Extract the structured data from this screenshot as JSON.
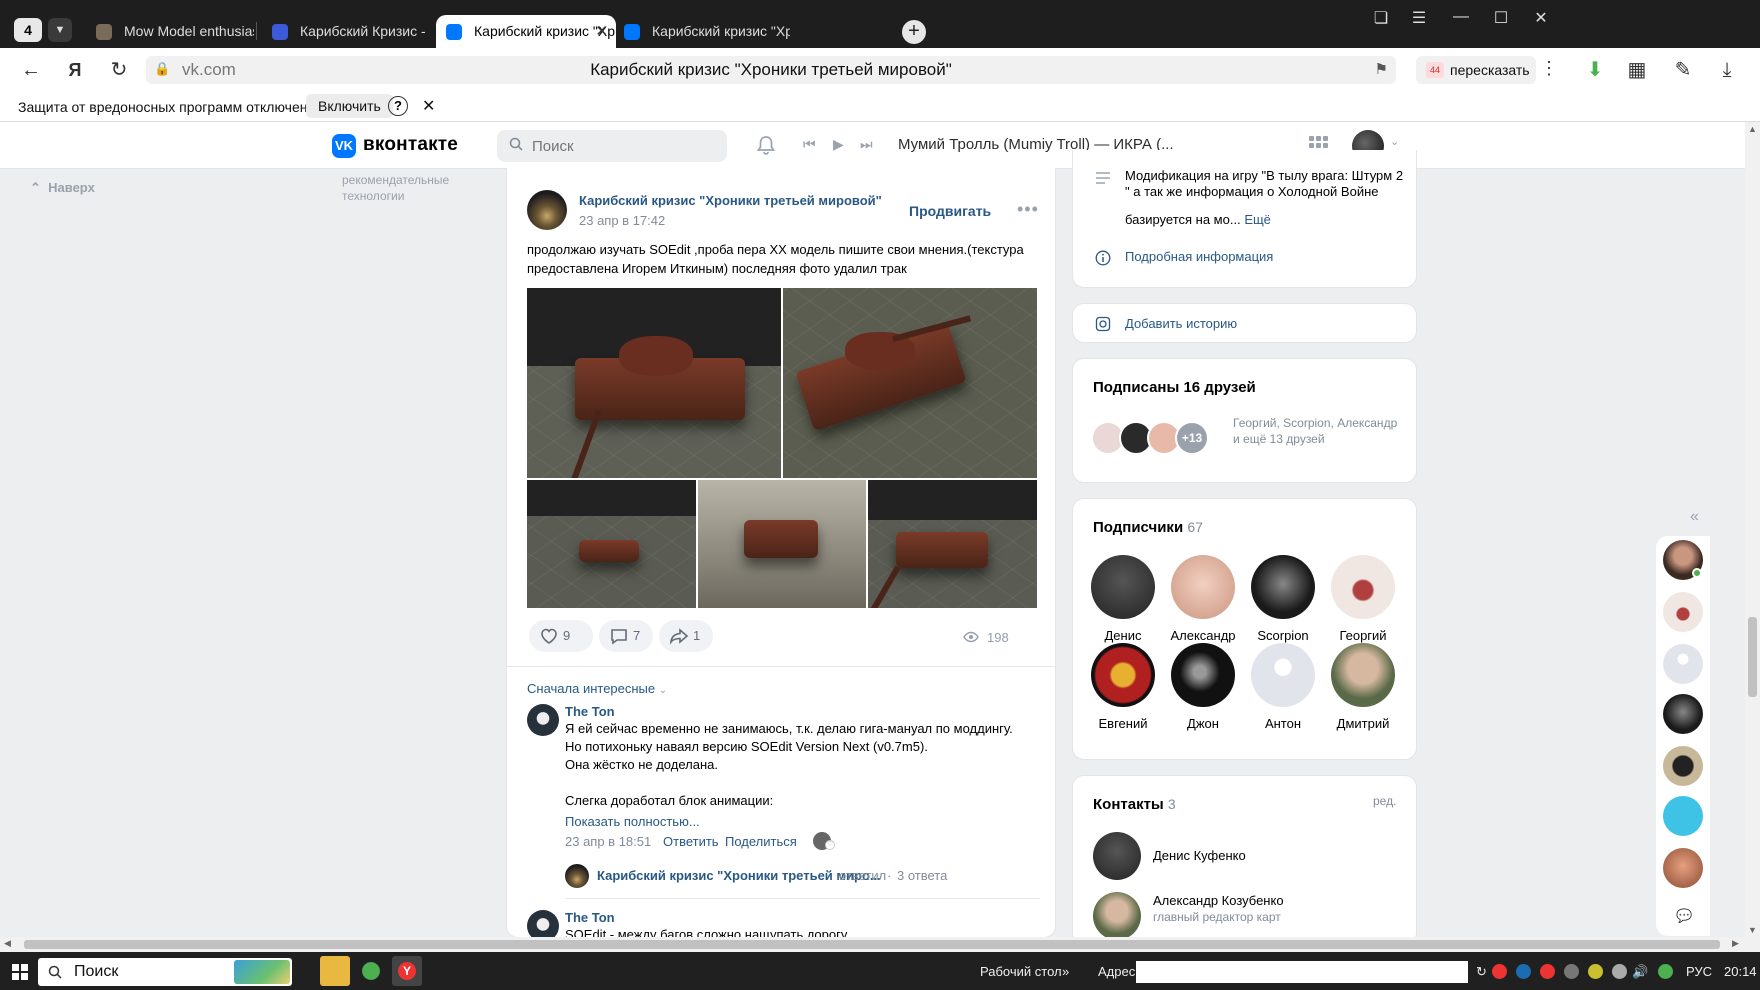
{
  "browser": {
    "tab_count": "4",
    "tabs": [
      {
        "title": "Mow Model enthusiasts - S"
      },
      {
        "title": "Карибский Кризис - Хрон"
      },
      {
        "title": "Карибский кризис \"Хр"
      },
      {
        "title": "Карибский кризис \"Хрон"
      }
    ],
    "url": "vk.com",
    "page_title": "Карибский кризис \"Хроники третьей мировой\"",
    "retell_badge": "44",
    "retell_label": "пересказать",
    "infobar_message": "Защита от вредоносных программ отключена",
    "infobar_button": "Включить"
  },
  "vk": {
    "logo_mark": "VK",
    "logo_text": "вконтакте",
    "search_placeholder": "Поиск",
    "now_playing": "Мумий Тролль (Mumiy Troll) — ИКРА (..."
  },
  "left": {
    "to_top": "Наверх",
    "rec_tech": "рекомендательные технологии"
  },
  "post": {
    "author": "Карибский кризис \"Хроники третьей мировой\"",
    "date": "23 апр в 17:42",
    "promote": "Продвигать",
    "text": "продолжаю изучать SOEdit ,проба пера XX модель пишите свои мнения.(текстура предоставлена Игорем Иткиным) последняя фото удалил трак",
    "likes": "9",
    "comments": "7",
    "shares": "1",
    "views": "198",
    "sort_label": "Сначала интересные"
  },
  "comments": [
    {
      "author": "The Ton",
      "text_lines": [
        "Я ей сейчас временно не занимаюсь, т.к. делаю гига-мануал по моддингу.",
        "Но потихоньку наваял версию SOEdit Version Next (v0.7m5).",
        "Она жёстко не доделана.",
        "",
        "Слегка доработал блок анимации:"
      ],
      "show_full": "Показать полностью...",
      "date": "23 апр в 18:51",
      "reply": "Ответить",
      "share": "Поделиться",
      "thread_author": "Карибский кризис \"Хроники третьей миро...",
      "thread_action": "ответил",
      "thread_replies": "3 ответа"
    },
    {
      "author": "The Ton",
      "text": "SOEdit - между багов сложно нащупать дорогу"
    }
  ],
  "info": {
    "description": "Модификация на игру \"В тылу врага: Штурм 2 \" а так же информация о Холодной Войне",
    "description2": "базируется на мо...",
    "more": "Ещё",
    "details": "Подробная информация",
    "add_story": "Добавить историю"
  },
  "friends": {
    "title": "Подписаны 16 друзей",
    "extra": "+13",
    "desc": "Георгий, Scorpion, Александр и ещё 13 друзей"
  },
  "subscribers": {
    "title": "Подписчики",
    "count": "67",
    "people": [
      {
        "name": "Денис",
        "color": "#3b3b3b"
      },
      {
        "name": "Александр",
        "color": "#e8b9a8"
      },
      {
        "name": "Scorpion",
        "color": "#2a2a2a"
      },
      {
        "name": "Георгий",
        "color": "#e9d8d5"
      },
      {
        "name": "Евгений",
        "color": "#b02020"
      },
      {
        "name": "Джон",
        "color": "#1c1c1c"
      },
      {
        "name": "Антон",
        "color": "#e1e5eb"
      },
      {
        "name": "Дмитрий",
        "color": "#9a8a78"
      }
    ]
  },
  "contacts": {
    "title": "Контакты",
    "count": "3",
    "edit": "ред.",
    "people": [
      {
        "name": "Денис Куфенко",
        "sub": ""
      },
      {
        "name": "Александр Козубенко",
        "sub": "главный редактор карт"
      }
    ]
  },
  "taskbar": {
    "search": "Поиск",
    "desktop": "Рабочий стол",
    "address": "Адрес",
    "lang": "РУС",
    "time": "20:14"
  }
}
